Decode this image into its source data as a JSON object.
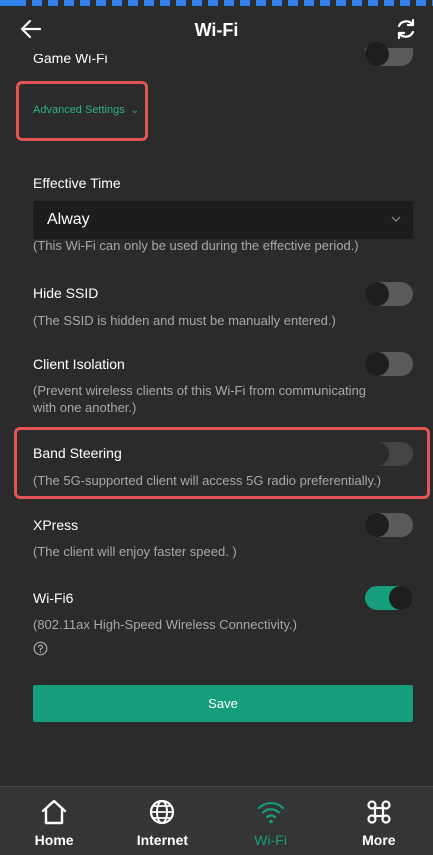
{
  "header": {
    "title": "Wi-Fi",
    "back_icon": "arrow-left-icon",
    "refresh_icon": "refresh-icon"
  },
  "settings": {
    "game_wifi": {
      "label": "Game Wi-Fi",
      "enabled": false
    },
    "advanced_link": "Advanced Settings",
    "effective_time": {
      "label": "Effective Time",
      "selected": "Alway",
      "hint": "(This Wi-Fi can only be used during the effective period.)"
    },
    "hide_ssid": {
      "label": "Hide SSID",
      "hint": "(The SSID is hidden and must be manually entered.)",
      "enabled": false
    },
    "client_isolation": {
      "label": "Client Isolation",
      "hint_line1": "(Prevent wireless clients of this Wi-Fi from communicating",
      "hint_line2": "with one another.)",
      "enabled": false
    },
    "band_steering": {
      "label": "Band Steering",
      "hint": "(The 5G-supported client will access 5G radio preferentially.)",
      "enabled": false
    },
    "xpress": {
      "label": "XPress",
      "hint": "(The client will enjoy faster speed. )",
      "enabled": false
    },
    "wifi6": {
      "label": "Wi-Fi6",
      "hint": "(802.11ax High-Speed Wireless Connectivity.)",
      "enabled": true,
      "help_icon": "question-circle-icon"
    }
  },
  "save_label": "Save",
  "nav": [
    {
      "label": "Home",
      "icon": "home-icon",
      "active": false
    },
    {
      "label": "Internet",
      "icon": "globe-icon",
      "active": false
    },
    {
      "label": "Wi-Fi",
      "icon": "wifi-icon",
      "active": true
    },
    {
      "label": "More",
      "icon": "command-icon",
      "active": false
    }
  ],
  "colors": {
    "background": "#2b2b2b",
    "accent": "#169d7c",
    "highlight_border": "#e45454",
    "link": "#2fb386"
  }
}
